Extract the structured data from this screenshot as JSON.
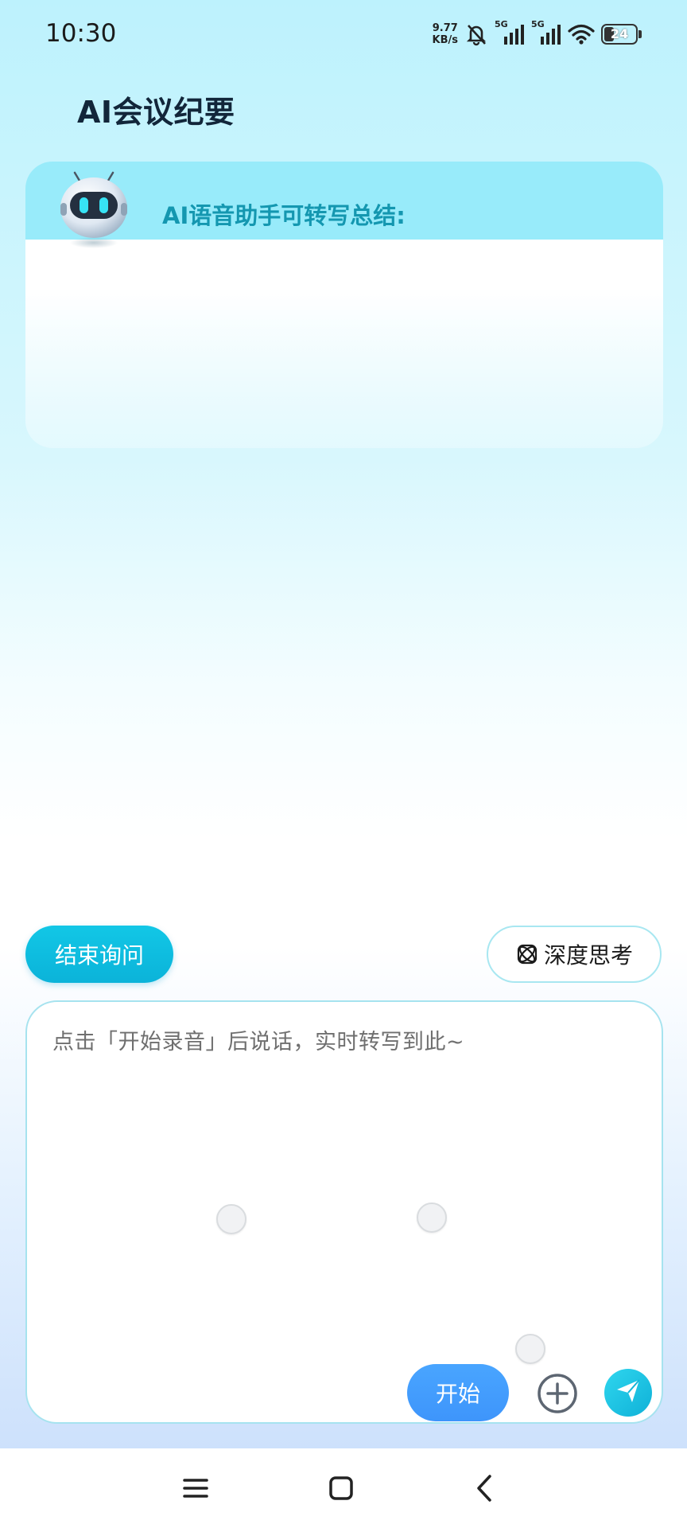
{
  "status_bar": {
    "time": "10:30",
    "net_speed_value": "9.77",
    "net_speed_unit": "KB/s",
    "signal_1_label": "5G",
    "signal_2_label": "5G",
    "battery_level": "24",
    "icons": [
      "bell-muted-icon",
      "signal-icon",
      "signal-icon",
      "wifi-icon",
      "battery-icon"
    ]
  },
  "page": {
    "title": "AI会议纪要"
  },
  "summary": {
    "label": "AI语音助手可转写总结:",
    "content": ""
  },
  "actions": {
    "end_label": "结束询问",
    "deep_think_label": "深度思考",
    "deep_think_icon": "atom-icon"
  },
  "input": {
    "placeholder": "点击「开始录音」后说话，实时转写到此~",
    "start_label": "开始",
    "plus_icon": "plus-circle-icon",
    "send_icon": "send-icon"
  },
  "nav": {
    "icons": [
      "menu-icon",
      "home-square-icon",
      "back-icon"
    ]
  },
  "colors": {
    "accent_cyan": "#0fb9dc",
    "start_blue": "#3e95fb",
    "title_dark": "#12263a",
    "label_teal": "#1497b0"
  }
}
